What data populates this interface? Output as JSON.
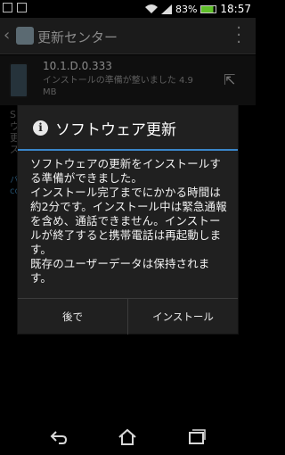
{
  "status_bar": {
    "battery": "83%",
    "time": "18:57"
  },
  "action_bar": {
    "title": "更新センター"
  },
  "update_item": {
    "version": "10.1.D.0.333",
    "status": "インストールの準備が整いました",
    "size": "4.9 MB"
  },
  "background": {
    "text_lines": [
      "S",
      "ウ",
      "更",
      "ズ"
    ],
    "link_lines": [
      "バ",
      "co"
    ]
  },
  "dialog": {
    "title": "ソフトウェア更新",
    "body": "ソフトウェアの更新をインストールする準備ができました。\nインストール完了までにかかる時間は約2分です。インストール中は緊急通報を含め、通話できません。インストールが終了すると携帯電話は再起動します。\n既存のユーザーデータは保持されます。",
    "later_label": "後で",
    "install_label": "インストール"
  }
}
